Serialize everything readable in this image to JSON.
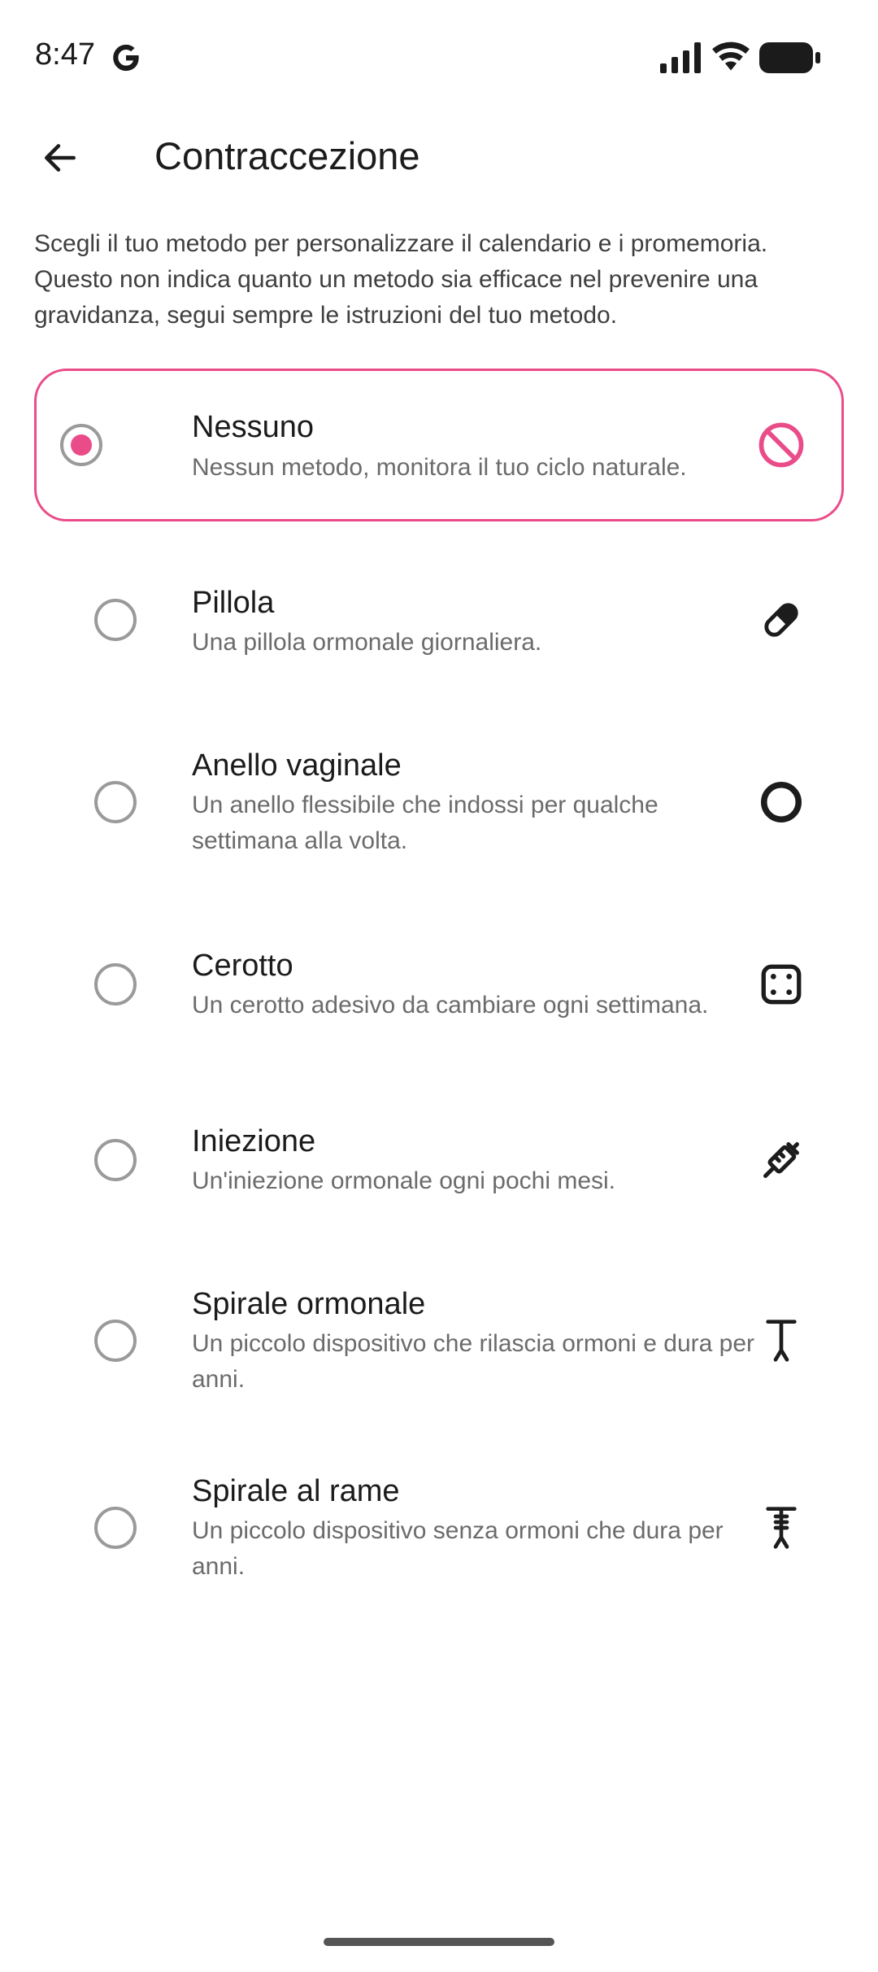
{
  "status_bar": {
    "time": "8:47"
  },
  "header": {
    "title": "Contraccezione"
  },
  "intro_text": "Scegli il tuo metodo per personalizzare il calendario e i promemoria. Questo non indica quanto un metodo sia efficace nel prevenire una gravidanza,  segui sempre le istruzioni del tuo metodo.",
  "accent_color": "#ea4c89",
  "options": [
    {
      "title": "Nessuno",
      "description": "Nessun metodo,  monitora il tuo ciclo naturale.",
      "icon": "no-symbol-icon",
      "selected": true
    },
    {
      "title": "Pillola",
      "description": "Una pillola ormonale giornaliera.",
      "icon": "pill-icon",
      "selected": false
    },
    {
      "title": "Anello vaginale",
      "description": "Un anello flessibile che indossi per qualche settimana alla volta.",
      "icon": "ring-icon",
      "selected": false
    },
    {
      "title": "Cerotto",
      "description": "Un cerotto adesivo da cambiare ogni settimana.",
      "icon": "patch-icon",
      "selected": false
    },
    {
      "title": "Iniezione",
      "description": "Un'iniezione ormonale ogni pochi mesi.",
      "icon": "syringe-icon",
      "selected": false
    },
    {
      "title": "Spirale ormonale",
      "description": "Un piccolo dispositivo che rilascia ormoni e dura per anni.",
      "icon": "hormonal-iud-icon",
      "selected": false
    },
    {
      "title": "Spirale al rame",
      "description": "Un piccolo dispositivo senza ormoni che dura per anni.",
      "icon": "copper-iud-icon",
      "selected": false
    }
  ]
}
